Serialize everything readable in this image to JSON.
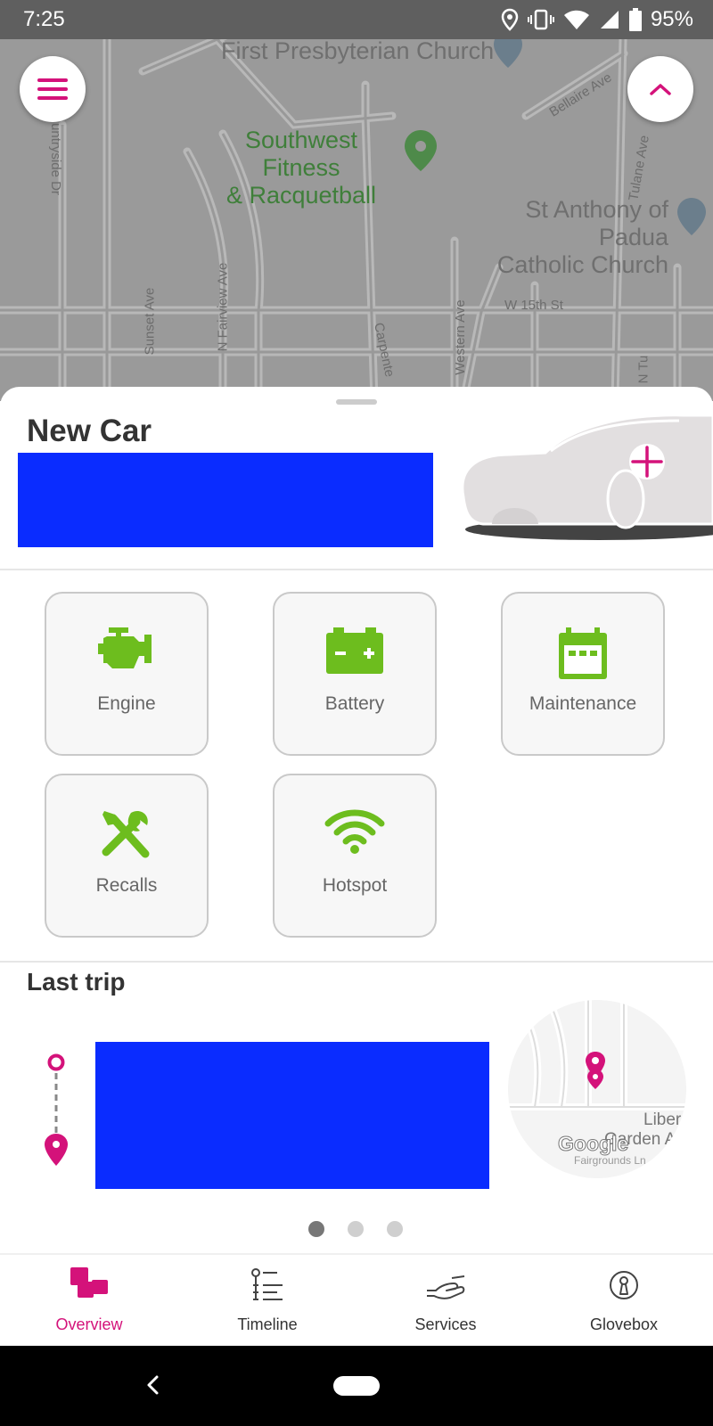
{
  "status_bar": {
    "time": "7:25",
    "battery": "95%"
  },
  "map": {
    "poi": {
      "church_1": "First Presbyterian Church",
      "fitness_line1": "Southwest Fitness",
      "fitness_line2": "& Racquetball",
      "church_2_line1": "St Anthony of Padua",
      "church_2_line2": "Catholic Church"
    },
    "streets": {
      "bellaire": "Bellaire Ave",
      "tulane": "Tulane Ave",
      "w15th": "W 15th St",
      "sunset": "Sunset Ave",
      "fairview": "N Fairview Ave",
      "carpenter": "Carpente",
      "western": "Western Ave",
      "countryside": "untryside Dr",
      "ntu": "N Tu"
    }
  },
  "vehicle": {
    "title": "New Car"
  },
  "tiles": [
    {
      "label": "Engine",
      "icon": "engine-icon"
    },
    {
      "label": "Battery",
      "icon": "battery-icon"
    },
    {
      "label": "Maintenance",
      "icon": "calendar-icon"
    },
    {
      "label": "Recalls",
      "icon": "tools-icon"
    },
    {
      "label": "Hotspot",
      "icon": "wifi-icon"
    }
  ],
  "last_trip": {
    "title": "Last trip",
    "map": {
      "place_line1": "Liber",
      "place_line2": "Garden A",
      "road": "Fairgrounds Ln",
      "logo": "Google"
    },
    "pager": {
      "pages": 3,
      "active": 1
    }
  },
  "bottom_nav": [
    {
      "label": "Overview",
      "active": true
    },
    {
      "label": "Timeline",
      "active": false
    },
    {
      "label": "Services",
      "active": false
    },
    {
      "label": "Glovebox",
      "active": false
    }
  ],
  "colors": {
    "accent": "#d4127a",
    "tile_icon": "#6dbd1e",
    "redacted": "#0a2cff"
  }
}
